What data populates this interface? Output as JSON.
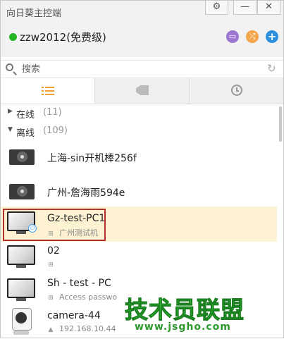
{
  "window": {
    "title": "向日葵主控端",
    "settings_glyph": "⚙",
    "minimize_glyph": "—",
    "close_glyph": "✕"
  },
  "account": {
    "name": "zzw2012(免费级)",
    "status_color": "#24b424",
    "buttons": [
      {
        "icon": "monitor-icon",
        "color": "#9e77d3",
        "glyph": "▭"
      },
      {
        "icon": "remote-connect-icon",
        "color": "#f4a44a",
        "glyph": "⤮"
      },
      {
        "icon": "add-icon",
        "color": "#2f8fdf",
        "glyph": "+"
      }
    ]
  },
  "search": {
    "placeholder": "搜索",
    "value": "",
    "refresh_glyph": "↻"
  },
  "tabs": [
    {
      "icon": "list-icon",
      "active": true
    },
    {
      "icon": "tag-icon",
      "active": false
    },
    {
      "icon": "history-clock-icon",
      "active": false
    }
  ],
  "groups": {
    "online": {
      "label": "在线",
      "count": "(11)",
      "expanded": false,
      "arrow": "▶"
    },
    "offline": {
      "label": "离线",
      "count": "(109)",
      "expanded": true,
      "arrow": "▼"
    }
  },
  "devices": [
    {
      "name": "上海-sin开机棒256f",
      "type": "boot-stick",
      "sub": ""
    },
    {
      "name": "广州-詹海雨594e",
      "type": "boot-stick",
      "sub": ""
    },
    {
      "name": "Gz-test-PC1",
      "type": "pc",
      "os": "windows",
      "sub": "广州测试机",
      "selected": true
    },
    {
      "name": "02",
      "type": "pc",
      "os": "windows",
      "sub": ""
    },
    {
      "name": "Sh - test - PC",
      "type": "pc",
      "os": "windows",
      "sub": "Access passwo"
    },
    {
      "name": "camera-44",
      "type": "camera",
      "os": "linux",
      "sub": "192.168.10.44"
    }
  ],
  "watermark": {
    "title": "技术员联盟",
    "url": "www.jsgho.com"
  },
  "colors": {
    "accent": "#f0a030",
    "selection_background": "#fdf2d2",
    "selection_border": "#b3302c",
    "watermark_green": "#33d43a"
  }
}
